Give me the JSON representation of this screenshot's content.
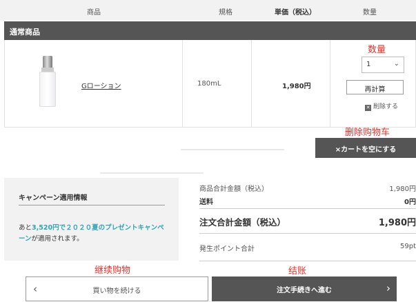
{
  "table_header": {
    "product": "商品",
    "spec": "規格",
    "unit_price": "単価（税込）",
    "quantity": "数量"
  },
  "section": {
    "title": "通常商品"
  },
  "item": {
    "name": "Gローション",
    "spec": "180mL",
    "price": "1,980円",
    "quantity_value": "1",
    "recalc_label": "再計算",
    "delete_label": "削除する"
  },
  "annotations": {
    "quantity": "数量",
    "empty_cart": "删除购物车",
    "continue": "继续购物",
    "checkout": "结账"
  },
  "empty_cart_label": "×カートを空にする",
  "campaign": {
    "title": "キャンペーン適用情報",
    "text_prefix": "あと",
    "text_highlight": "3,520円で２０２０夏のプレゼントキャンペーン",
    "text_suffix": "が適用されます。"
  },
  "summary": {
    "subtotal_label": "商品合計金額（税込）",
    "subtotal_value": "1,980円",
    "shipping_label": "送料",
    "shipping_value": "0円",
    "total_label": "注文合計金額（税込）",
    "total_value": "1,980円",
    "points_label": "発生ポイント合計",
    "points_value": "59pt"
  },
  "buttons": {
    "continue_shopping": "買い物を続ける",
    "checkout": "注文手続きへ進む"
  },
  "colors": {
    "dark_bar": "#555555",
    "annotation": "#e8302a",
    "highlight": "#2ea4b6"
  }
}
